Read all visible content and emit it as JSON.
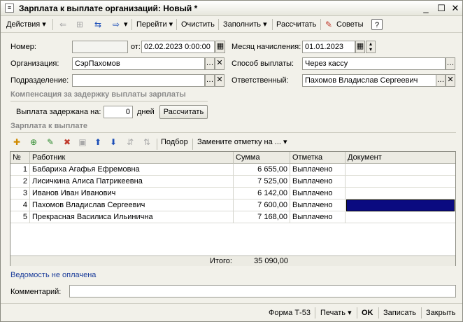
{
  "window": {
    "title": "Зарплата к выплате организаций: Новый *"
  },
  "toolbar": {
    "actions": "Действия",
    "goto": "Перейти",
    "clear": "Очистить",
    "fill": "Заполнить",
    "calculate": "Рассчитать",
    "tips": "Советы",
    "help": "?"
  },
  "form": {
    "number_label": "Номер:",
    "number_value": "",
    "from_label": "от:",
    "date_value": "02.02.2023  0:00:00",
    "month_label": "Месяц начисления:",
    "month_value": "01.01.2023",
    "org_label": "Организация:",
    "org_value": "СэрПахомов",
    "payment_label": "Способ выплаты:",
    "payment_value": "Через кассу",
    "dept_label": "Подразделение:",
    "dept_value": "",
    "responsible_label": "Ответственный:",
    "responsible_value": "Пахомов Владислав Сергеевич"
  },
  "compensation": {
    "title": "Компенсация за задержку выплаты зарплаты",
    "delay_label": "Выплата задержана на:",
    "delay_value": "0",
    "days_label": "дней",
    "calc_button": "Рассчитать"
  },
  "payout": {
    "title": "Зарплата к выплате",
    "selection": "Подбор",
    "replace_mark": "Замените отметку на ..."
  },
  "table": {
    "headers": [
      "№",
      "Работник",
      "Сумма",
      "Отметка",
      "Документ"
    ],
    "rows": [
      {
        "n": "1",
        "worker": "Бабариха Агафья Ефремовна",
        "sum": "6 655,00",
        "mark": "Выплачено",
        "doc": ""
      },
      {
        "n": "2",
        "worker": "Лисичкина Алиса Патрикеевна",
        "sum": "7 525,00",
        "mark": "Выплачено",
        "doc": ""
      },
      {
        "n": "3",
        "worker": "Иванов Иван Иванович",
        "sum": "6 142,00",
        "mark": "Выплачено",
        "doc": ""
      },
      {
        "n": "4",
        "worker": "Пахомов Владислав Сергеевич",
        "sum": "7 600,00",
        "mark": "Выплачено",
        "doc": ""
      },
      {
        "n": "5",
        "worker": "Прекрасная Василиса Ильинична",
        "sum": "7 168,00",
        "mark": "Выплачено",
        "doc": ""
      }
    ],
    "total_label": "Итого:",
    "total_value": "35 090,00",
    "selected_color": "#0a0a80"
  },
  "status": {
    "unpaid_link": "Ведомость не оплачена"
  },
  "comment": {
    "label": "Комментарий:",
    "value": ""
  },
  "bottom": {
    "form_t53": "Форма Т-53",
    "print": "Печать",
    "ok": "OK",
    "save": "Записать",
    "close": "Закрыть"
  }
}
